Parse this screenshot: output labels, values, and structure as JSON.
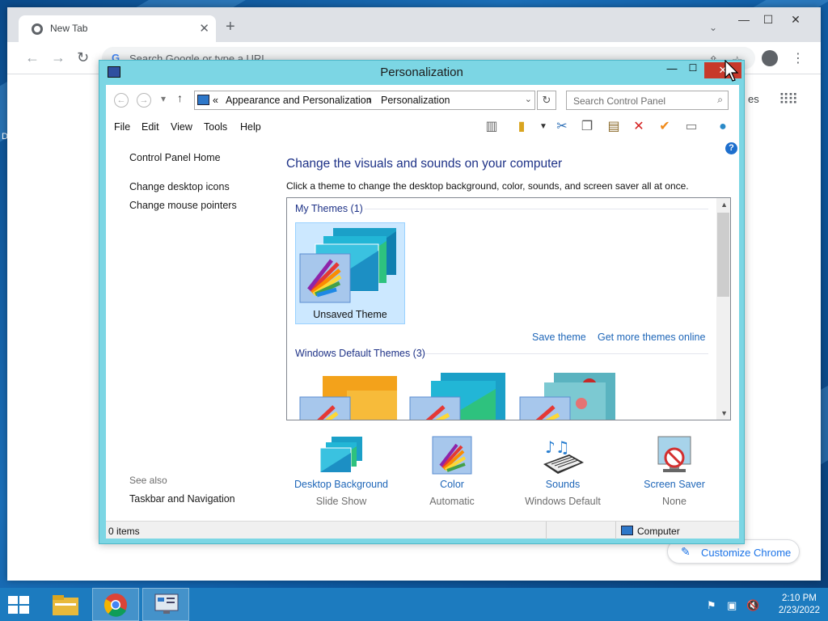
{
  "desktop": {
    "edge_letter": "D"
  },
  "chrome": {
    "tab_title": "New Tab",
    "tab_close": "✕",
    "new_tab": "+",
    "tab_search": "⌄",
    "window_controls": {
      "minimize": "—",
      "maximize": "☐",
      "close": "✕"
    },
    "omnibox_placeholder": "Search Google or type a URL",
    "omnibox_g": "G",
    "ntp_partial_text": "es",
    "customize_label": "Customize Chrome"
  },
  "control_panel": {
    "title": "Personalization",
    "controls": {
      "minimize": "—",
      "maximize": "☐",
      "close": "✕"
    },
    "breadcrumb": {
      "prefix": "«",
      "items": [
        "Appearance and Personalization",
        "Personalization"
      ],
      "separator": "›"
    },
    "search_placeholder": "Search Control Panel",
    "menu": [
      "File",
      "Edit",
      "View",
      "Tools",
      "Help"
    ],
    "left_nav": {
      "home": "Control Panel Home",
      "links": [
        "Change desktop icons",
        "Change mouse pointers"
      ],
      "see_also_label": "See also",
      "see_also_links": [
        "Taskbar and Navigation"
      ]
    },
    "heading": "Change the visuals and sounds on your computer",
    "description": "Click a theme to change the desktop background, color, sounds, and screen saver all at once.",
    "my_themes_header": "My Themes (1)",
    "my_themes": [
      {
        "label": "Unsaved Theme",
        "selected": true
      }
    ],
    "save_theme": "Save theme",
    "get_more_themes": "Get more themes online",
    "default_themes_header": "Windows Default Themes (3)",
    "bottom_items": [
      {
        "title": "Desktop Background",
        "subtitle": "Slide Show",
        "icon": "desktop-background-icon"
      },
      {
        "title": "Color",
        "subtitle": "Automatic",
        "icon": "color-icon"
      },
      {
        "title": "Sounds",
        "subtitle": "Windows Default",
        "icon": "sounds-icon"
      },
      {
        "title": "Screen Saver",
        "subtitle": "None",
        "icon": "screen-saver-icon"
      }
    ],
    "status_left": "0 items",
    "status_right": "Computer"
  },
  "taskbar": {
    "clock_time": "2:10 PM",
    "clock_date": "2/23/2022"
  },
  "colors": {
    "window_accent": "#7cd6e4",
    "taskbar": "#1c7bbf",
    "link": "#1e66b8",
    "heading": "#1e3287",
    "close_button": "#c7392b",
    "selected_tile": "#cce8ff"
  }
}
